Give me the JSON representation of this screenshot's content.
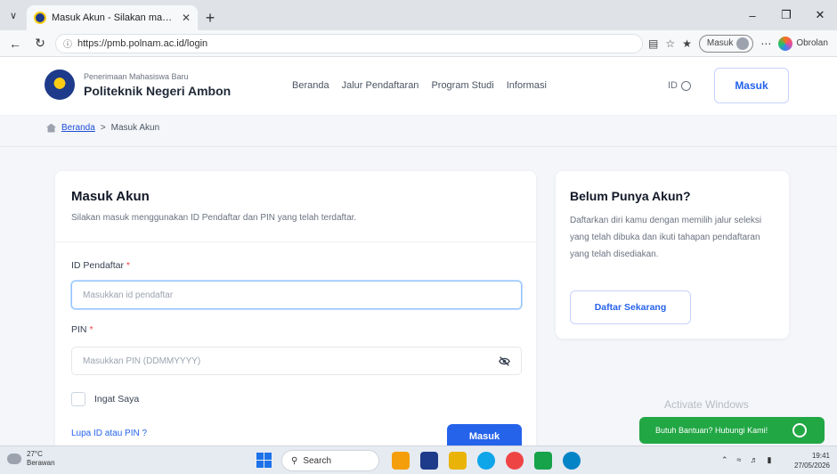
{
  "browser": {
    "tab_title": "Masuk Akun - Silakan masuk men…",
    "url": "https://pmb.polnam.ac.id/login",
    "profile_label": "Masuk",
    "copilot_label": "Obrolan"
  },
  "header": {
    "subtitle": "Penerimaan Mahasiswa Baru",
    "title": "Politeknik Negeri Ambon",
    "menu": [
      "Beranda",
      "Jalur Pendaftaran",
      "Program Studi",
      "Informasi"
    ],
    "lang": "ID",
    "login_button": "Masuk"
  },
  "breadcrumb": {
    "home": "Beranda",
    "separator": ">",
    "current": "Masuk Akun"
  },
  "login": {
    "title": "Masuk Akun",
    "description": "Silakan masuk menggunakan ID Pendaftar dan PIN yang telah terdaftar.",
    "id_label": "ID Pendaftar",
    "id_placeholder": "Masukkan id pendaftar",
    "pin_label": "PIN",
    "pin_placeholder": "Masukkan PIN (DDMMYYYY)",
    "required_mark": "*",
    "remember_label": "Ingat Saya",
    "forgot_link": "Lupa ID atau PIN ?",
    "submit_label": "Masuk"
  },
  "register": {
    "title": "Belum Punya Akun?",
    "description": "Daftarkan diri kamu dengan memilih jalur seleksi yang telah dibuka dan ikuti tahapan pendaftaran yang telah disediakan.",
    "button": "Daftar Sekarang"
  },
  "watermark": "Activate Windows",
  "help_chat": "Butuh Bantuan? Hubungi Kami!",
  "taskbar": {
    "temperature": "27°C",
    "weather": "Berawan",
    "search": "Search",
    "time": "19:41",
    "date": "27/05/2026"
  },
  "colors": {
    "primary": "#2563eb",
    "help_green": "#22a745",
    "background": "#f4f6f9"
  }
}
